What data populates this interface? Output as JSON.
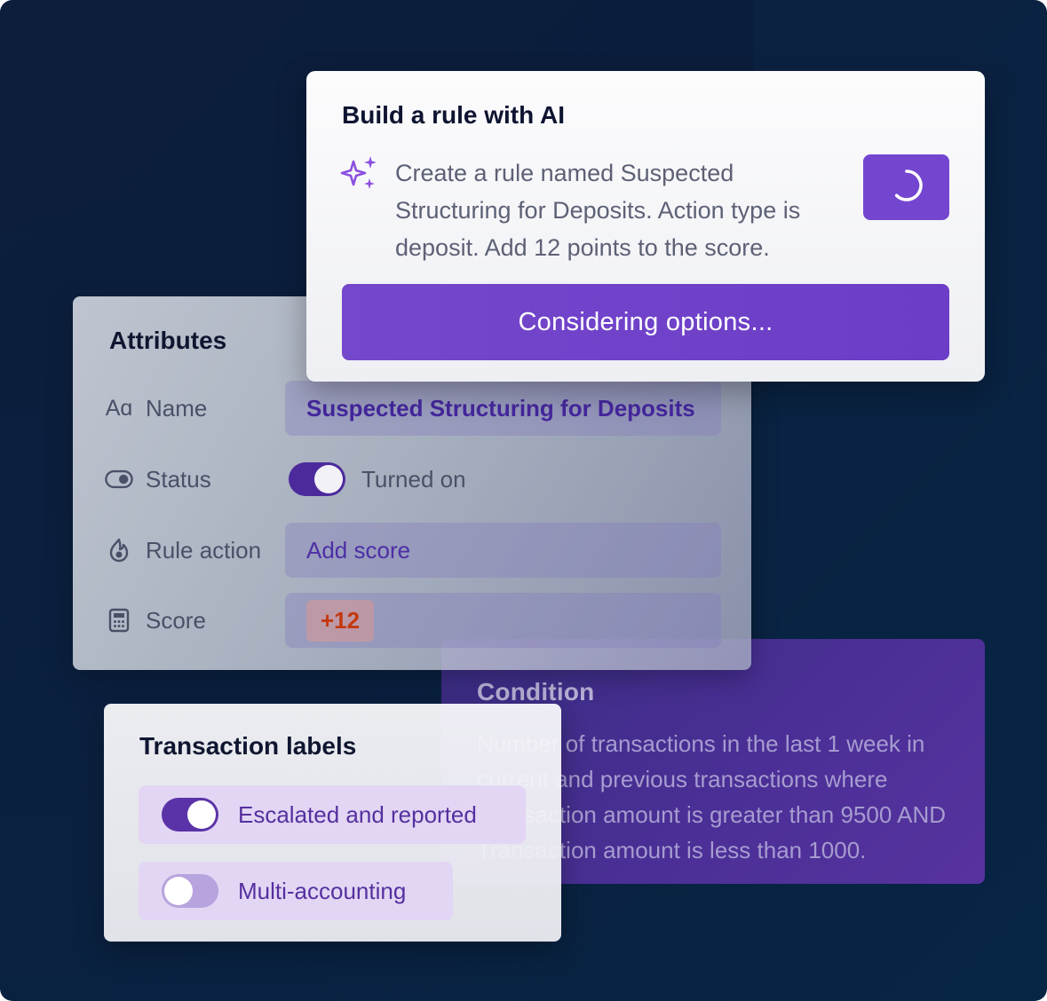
{
  "condition": {
    "title": "Condition",
    "text": "Number of transactions in the last 1 week in current and previous transactions where Transaction amount is greater than 9500 AND Transaction amount is less than 1000."
  },
  "attributes": {
    "title": "Attributes",
    "name_label": "Name",
    "name_value": "Suspected Structuring for Deposits",
    "status_label": "Status",
    "status_value": "Turned on",
    "rule_action_label": "Rule action",
    "rule_action_value": "Add score",
    "score_label": "Score",
    "score_value": "+12"
  },
  "ai_builder": {
    "title": "Build a rule with AI",
    "prompt": "Create a rule named Suspected Structuring for Deposits. Action type is deposit. Add 12 points to the score.",
    "action_label": "Considering options..."
  },
  "transaction_labels": {
    "title": "Transaction labels",
    "items": [
      {
        "label": "Escalated and reported",
        "enabled": true
      },
      {
        "label": "Multi-accounting",
        "enabled": false
      }
    ]
  },
  "colors": {
    "background": "#0b2241",
    "accent": "#7446d0",
    "score": "#c3390f"
  },
  "icons": {
    "name": "text-aa-icon",
    "status": "toggle-icon",
    "rule_action": "flame-icon",
    "score": "calculator-icon",
    "ai": "sparkle-icon",
    "loading": "spinner-icon"
  }
}
